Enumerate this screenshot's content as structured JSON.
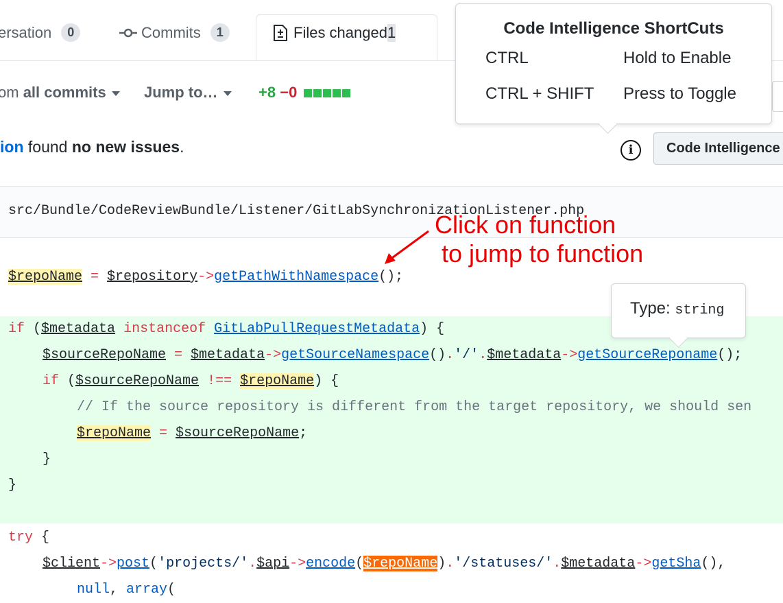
{
  "tabs": {
    "conversation": {
      "label": "ersation",
      "count": "0"
    },
    "commits": {
      "label": "Commits",
      "count": "1"
    },
    "files": {
      "label": "Files changed",
      "count": "1"
    }
  },
  "toolbar": {
    "commits_prefix": "om ",
    "commits_bold": "all commits",
    "jump": "Jump to…",
    "additions": "+8",
    "deletions": "−0"
  },
  "issues": {
    "link": "ion",
    "middle": " found ",
    "bold": "no new issues",
    "end": "."
  },
  "file": {
    "path": "src/Bundle/CodeReviewBundle/Listener/GitLabSynchronizationListener.php"
  },
  "shortcuts": {
    "title": "Code Intelligence ShortCuts",
    "rows": [
      {
        "key": "CTRL",
        "action": "Hold to Enable"
      },
      {
        "key": "CTRL + SHIFT",
        "action": "Press to Toggle"
      }
    ]
  },
  "ci_button": {
    "label": "Code Intelligence"
  },
  "info_icon": {
    "glyph": "i"
  },
  "type_popup": {
    "label": "Type: ",
    "type": "string"
  },
  "annotation": {
    "line1": "Click on function",
    "line2": " to jump to function"
  },
  "colors": {
    "added_bg": "#e6ffed",
    "highlight": "#fff5b1",
    "active_highlight": "#f66a0a",
    "annotation": "#ee0000",
    "link": "#0366d6"
  },
  "code": {
    "l1": {
      "v1": "$repoName",
      "op": " = ",
      "v2": "$repository",
      "arrow": "->",
      "fn": "getPathWithNamespace",
      "end": "();"
    },
    "l2": {
      "kw": "if",
      "p": " (",
      "v": "$metadata",
      "kw2": " instanceof ",
      "cls": "GitLabPullRequestMetadata",
      "end": ") {"
    },
    "l3": {
      "v1": "$sourceRepoName",
      "op": " = ",
      "v2": "$metadata",
      "a1": "->",
      "fn1": "getSourceNamespace",
      "m1": "()",
      "dot": ".",
      "s": "'/'",
      "dot2": ".",
      "v3": "$metadata",
      "a2": "->",
      "fn2": "getSourceReponame",
      "end": "();"
    },
    "l4": {
      "kw": "if",
      "p": " (",
      "v1": "$sourceRepoName",
      "op": " !== ",
      "v2": "$repoName",
      "end": ") {"
    },
    "l5": {
      "comment": "// If the source repository is different from the target repository, we should sen"
    },
    "l6": {
      "v1": "$repoName",
      "op": " = ",
      "v2": "$sourceRepoName",
      "end": ";"
    },
    "l7": {
      "text": "}"
    },
    "l8": {
      "text": "}"
    },
    "l9": {
      "kw": "try",
      "end": " {"
    },
    "l10": {
      "v1": "$client",
      "a1": "->",
      "fn1": "post",
      "p1": "(",
      "s1": "'projects/'",
      "d1": ".",
      "v2": "$api",
      "a2": "->",
      "fn2": "encode",
      "p2": "(",
      "v3": "$repoName",
      "p3": ")",
      "d2": ".",
      "s2": "'/statuses/'",
      "d3": ".",
      "v4": "$metadata",
      "a3": "->",
      "fn3": "getSha",
      "end": "(),"
    },
    "l11": {
      "lit": "null",
      "c": ", ",
      "fn": "array",
      "p": "("
    }
  }
}
